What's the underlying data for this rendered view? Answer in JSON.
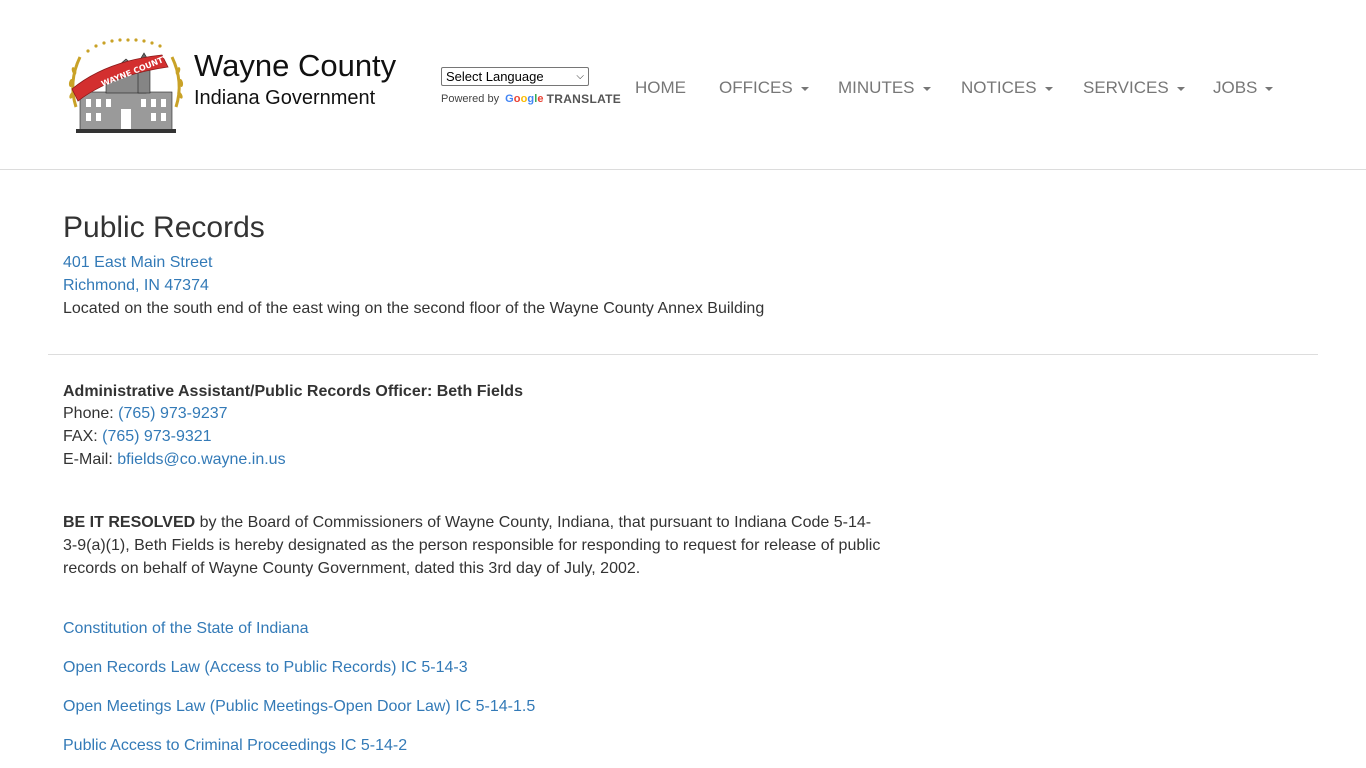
{
  "brand": {
    "title": "Wayne County",
    "subtitle": "Indiana Government",
    "logo_text": "WAYNE COUNTY"
  },
  "translate": {
    "select_label": "Select Language",
    "powered_by": "Powered by",
    "google": "Google",
    "translate_word": "TRANSLATE"
  },
  "nav": {
    "items": [
      {
        "label": "HOME",
        "dropdown": false
      },
      {
        "label": "OFFICES",
        "dropdown": true
      },
      {
        "label": "MINUTES",
        "dropdown": true
      },
      {
        "label": "NOTICES",
        "dropdown": true
      },
      {
        "label": "SERVICES",
        "dropdown": true
      },
      {
        "label": "JOBS",
        "dropdown": true
      }
    ]
  },
  "main": {
    "title": "Public Records",
    "address_line1": "401 East Main Street",
    "address_line2": "Richmond, IN 47374",
    "location_note": "Located on the south end of the east wing on the second floor of the Wayne County Annex Building",
    "officer_heading": "Administrative Assistant/Public Records Officer: Beth Fields",
    "phone_label": "Phone: ",
    "phone": "(765) 973-9237",
    "fax_label": "FAX: ",
    "fax": "(765) 973-9321",
    "email_label": "E-Mail: ",
    "email": "bfields@co.wayne.in.us",
    "resolution_bold": "BE IT RESOLVED",
    "resolution_text": " by the Board of Commissioners of Wayne County, Indiana, that pursuant to Indiana Code 5-14-3-9(a)(1), Beth Fields is hereby designated as the person responsible for responding to request for release of public records on behalf of Wayne County Government, dated this 3rd day of July, 2002.",
    "links": [
      "Constitution of the State of Indiana",
      "Open Records Law (Access to Public Records) IC 5-14-3",
      "Open Meetings Law (Public Meetings-Open Door Law) IC 5-14-1.5",
      "Public Access to Criminal Proceedings IC 5-14-2"
    ]
  },
  "colors": {
    "link": "#337ab7",
    "nav_text": "#777777",
    "text": "#333333",
    "logo_red": "#d32f2f",
    "logo_gold": "#c9a227"
  }
}
